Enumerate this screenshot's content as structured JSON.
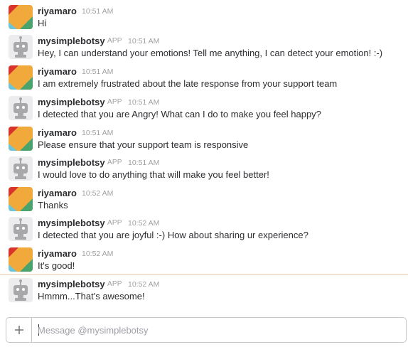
{
  "messages": [
    {
      "author": "riyamaro",
      "is_bot": false,
      "time": "10:51 AM",
      "text": "Hi"
    },
    {
      "author": "mysimplebotsy",
      "is_bot": true,
      "app_tag": "APP",
      "time": "10:51 AM",
      "text": "Hey, I can understand your emotions! Tell me anything, I can detect your emotion! :-)"
    },
    {
      "author": "riyamaro",
      "is_bot": false,
      "time": "10:51 AM",
      "text": "I  am extremely frustrated about the late response from your support team"
    },
    {
      "author": "mysimplebotsy",
      "is_bot": true,
      "app_tag": "APP",
      "time": "10:51 AM",
      "text": "I detected that you are Angry! What can I do to make you feel happy?"
    },
    {
      "author": "riyamaro",
      "is_bot": false,
      "time": "10:51 AM",
      "text": "Please ensure that your support team is responsive"
    },
    {
      "author": "mysimplebotsy",
      "is_bot": true,
      "app_tag": "APP",
      "time": "10:51 AM",
      "text": "I would love to do anything that will make you feel better!"
    },
    {
      "author": "riyamaro",
      "is_bot": false,
      "time": "10:52 AM",
      "text": "Thanks"
    },
    {
      "author": "mysimplebotsy",
      "is_bot": true,
      "app_tag": "APP",
      "time": "10:52 AM",
      "text": "I detected that you are joyful :-) How about sharing ur experience?"
    },
    {
      "author": "riyamaro",
      "is_bot": false,
      "time": "10:52 AM",
      "text": "It's good!"
    },
    {
      "author": "mysimplebotsy",
      "is_bot": true,
      "app_tag": "APP",
      "time": "10:52 AM",
      "text": "Hmmm...That's awesome!"
    }
  ],
  "composer": {
    "placeholder": "Message @mysimplebotsy",
    "value": ""
  },
  "icons": {
    "attach": "plus-icon",
    "user_avatar": "riyamaro-avatar-icon",
    "bot_avatar": "robot-avatar-icon"
  },
  "colors": {
    "user_avatar": [
      "#d9342b",
      "#f2a93b",
      "#4aa36c",
      "#6dc5d9"
    ],
    "bot_avatar": "#a8a8ab",
    "text": "#2c2d30",
    "meta": "#a0a0a2",
    "new_messages_divider": "#e8c9b0"
  }
}
